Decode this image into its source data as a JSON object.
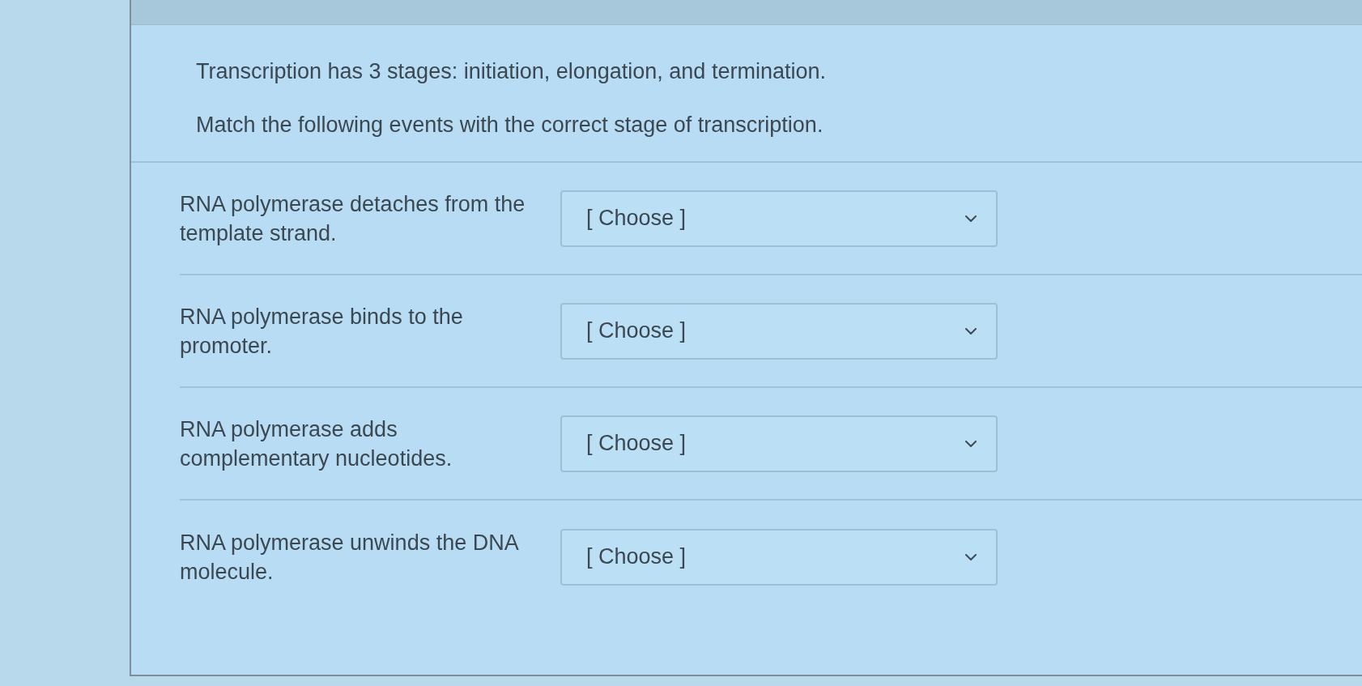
{
  "question": {
    "lines": [
      "Transcription has 3 stages: initiation, elongation, and termination.",
      "Match the following events with the correct stage of transcription."
    ]
  },
  "matches": [
    {
      "prompt": "RNA polymerase detaches from the template strand.",
      "select": {
        "value": "[ Choose ]"
      }
    },
    {
      "prompt": "RNA polymerase binds to the promoter.",
      "select": {
        "value": "[ Choose ]"
      }
    },
    {
      "prompt": "RNA polymerase adds complementary nucleotides.",
      "select": {
        "value": "[ Choose ]"
      }
    },
    {
      "prompt": "RNA polymerase unwinds the DNA molecule.",
      "select": {
        "value": "[ Choose ]"
      }
    }
  ]
}
